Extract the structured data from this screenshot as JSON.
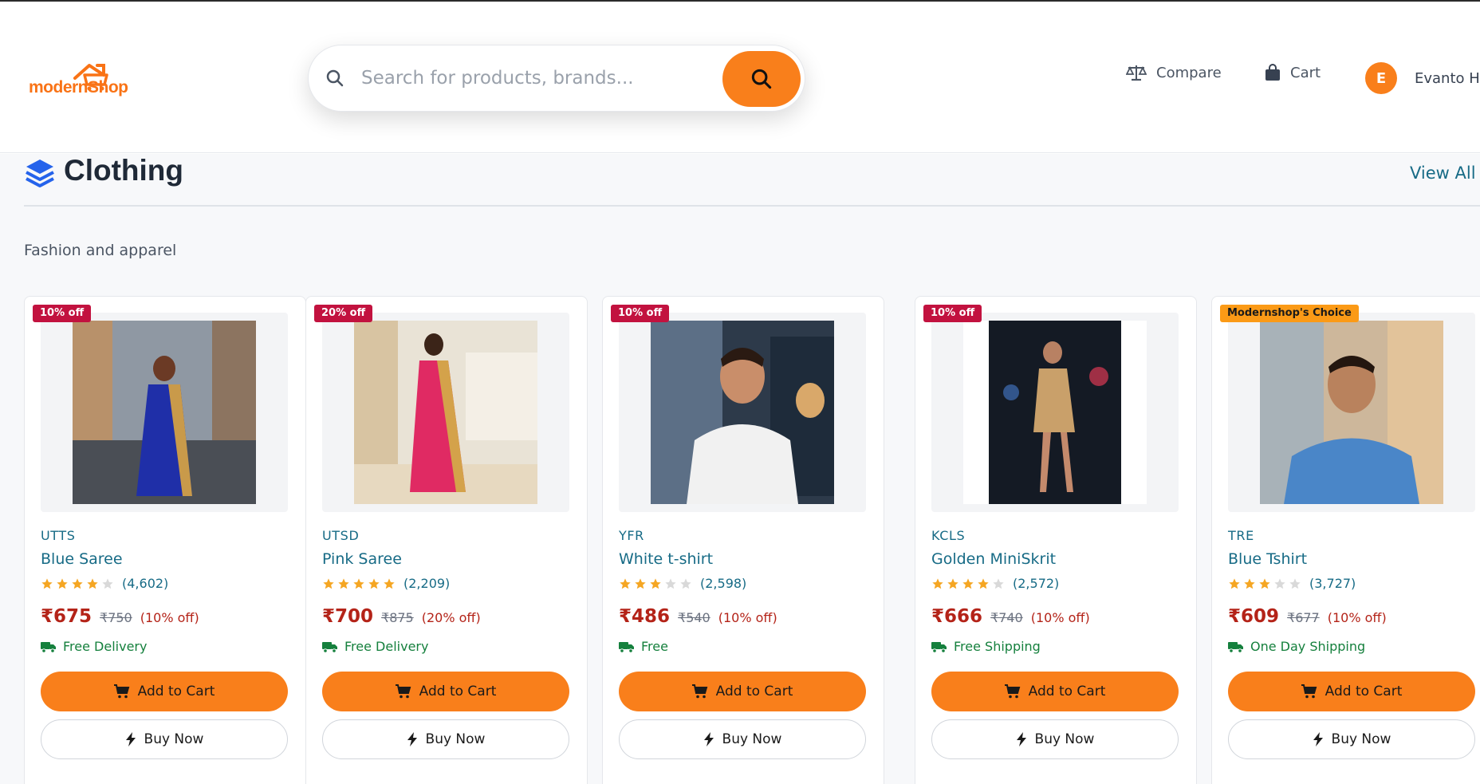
{
  "header": {
    "logo_text_a": "modern",
    "logo_text_b": "Shop",
    "search_placeholder": "Search for products, brands...",
    "compare_label": "Compare",
    "cart_label": "Cart",
    "user_initial": "E",
    "user_name": "Evanto Hos"
  },
  "section": {
    "title": "Clothing",
    "view_all": "View All",
    "subtitle": "Fashion and apparel"
  },
  "buttons": {
    "add_to_cart": "Add to Cart",
    "buy_now": "Buy Now"
  },
  "products": [
    {
      "badge": "10% off",
      "brand": "UTTS",
      "name": "Blue Saree",
      "rating": 4,
      "count": "(4,602)",
      "price": "₹675",
      "mrp": "₹750",
      "discount": "(10% off)",
      "shipping": "Free Delivery",
      "image": "woman-in-blue-saree-photo"
    },
    {
      "badge": "20% off",
      "brand": "UTSD",
      "name": "Pink Saree",
      "rating": 5,
      "count": "(2,209)",
      "price": "₹700",
      "mrp": "₹875",
      "discount": "(20% off)",
      "shipping": "Free Delivery",
      "image": "woman-in-pink-saree-photo"
    },
    {
      "badge": "10% off",
      "brand": "YFR",
      "name": "White t-shirt",
      "rating": 3,
      "count": "(2,598)",
      "price": "₹486",
      "mrp": "₹540",
      "discount": "(10% off)",
      "shipping": "Free",
      "image": "man-in-white-tshirt-photo"
    },
    {
      "badge": "10% off",
      "brand": "KCLS",
      "name": "Golden MiniSkrit",
      "rating": 4,
      "count": "(2,572)",
      "price": "₹666",
      "mrp": "₹740",
      "discount": "(10% off)",
      "shipping": "Free Shipping",
      "image": "woman-in-golden-dress-photo"
    },
    {
      "badge": "Modernshop's Choice",
      "brand": "TRE",
      "name": "Blue Tshirt",
      "rating": 3,
      "count": "(3,727)",
      "price": "₹609",
      "mrp": "₹677",
      "discount": "(10% off)",
      "shipping": "One Day Shipping",
      "image": "man-in-blue-tshirt-photo"
    }
  ],
  "colors": {
    "accent": "#f97f1b",
    "link": "#176b86",
    "price": "#b42318",
    "badge": "#c2123f",
    "shipping": "#15803d"
  }
}
